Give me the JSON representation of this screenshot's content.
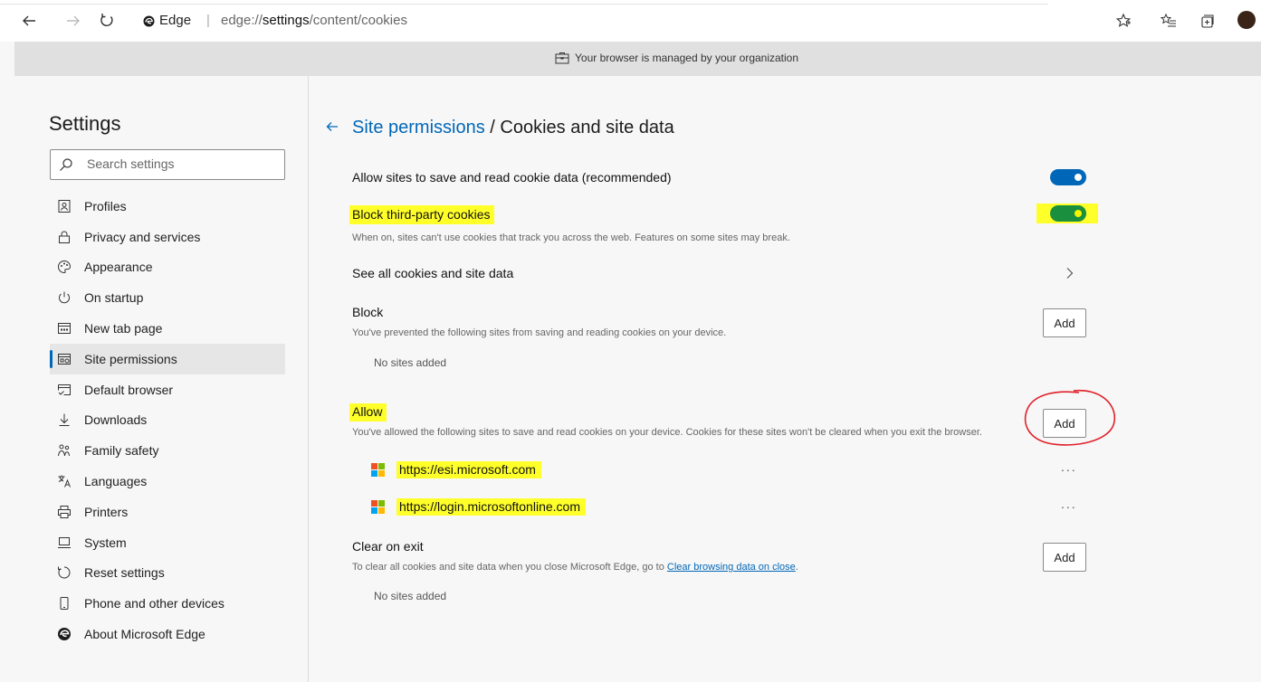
{
  "browser": {
    "address_edge_label": "Edge",
    "address_separator": "|",
    "url_prefix": "edge://",
    "url_host": "settings",
    "url_path": "/content/cookies"
  },
  "managed_banner": "Your browser is managed by your organization",
  "sidebar": {
    "title": "Settings",
    "search_placeholder": "Search settings",
    "items": [
      {
        "label": "Profiles",
        "icon": "profile-icon"
      },
      {
        "label": "Privacy and services",
        "icon": "lock-icon"
      },
      {
        "label": "Appearance",
        "icon": "palette-icon"
      },
      {
        "label": "On startup",
        "icon": "power-icon"
      },
      {
        "label": "New tab page",
        "icon": "new-tab-icon"
      },
      {
        "label": "Site permissions",
        "icon": "site-permissions-icon",
        "active": true
      },
      {
        "label": "Default browser",
        "icon": "default-browser-icon"
      },
      {
        "label": "Downloads",
        "icon": "download-icon"
      },
      {
        "label": "Family safety",
        "icon": "family-icon"
      },
      {
        "label": "Languages",
        "icon": "language-icon"
      },
      {
        "label": "Printers",
        "icon": "printer-icon"
      },
      {
        "label": "System",
        "icon": "laptop-icon"
      },
      {
        "label": "Reset settings",
        "icon": "reset-icon"
      },
      {
        "label": "Phone and other devices",
        "icon": "phone-icon"
      },
      {
        "label": "About Microsoft Edge",
        "icon": "edge-logo-icon"
      }
    ]
  },
  "content": {
    "breadcrumb_parent": "Site permissions",
    "breadcrumb_sep": " / ",
    "breadcrumb_current": "Cookies and site data",
    "allow_cookies_label": "Allow sites to save and read cookie data (recommended)",
    "allow_cookies_on": true,
    "block_third_party_label": "Block third-party cookies",
    "block_third_party_desc": "When on, sites can't use cookies that track you across the web. Features on some sites may break.",
    "block_third_party_on": true,
    "see_all_label": "See all cookies and site data",
    "block_section": {
      "title": "Block",
      "desc": "You've prevented the following sites from saving and reading cookies on your device.",
      "add_label": "Add",
      "empty": "No sites added"
    },
    "allow_section": {
      "title": "Allow",
      "desc": "You've allowed the following sites to save and read cookies on your device. Cookies for these sites won't be cleared when you exit the browser.",
      "add_label": "Add",
      "sites": [
        "https://esi.microsoft.com",
        "https://login.microsoftonline.com"
      ],
      "more_label": "..."
    },
    "clear_section": {
      "title": "Clear on exit",
      "desc_prefix": "To clear all cookies and site data when you close Microsoft Edge, go to ",
      "desc_link": "Clear browsing data on close",
      "desc_suffix": ".",
      "add_label": "Add",
      "empty": "No sites added"
    }
  },
  "colors": {
    "accent": "#0067b8",
    "highlight": "#ffff2a",
    "toggle_green": "#1a8f3e",
    "annotation_red": "#e0202a"
  }
}
